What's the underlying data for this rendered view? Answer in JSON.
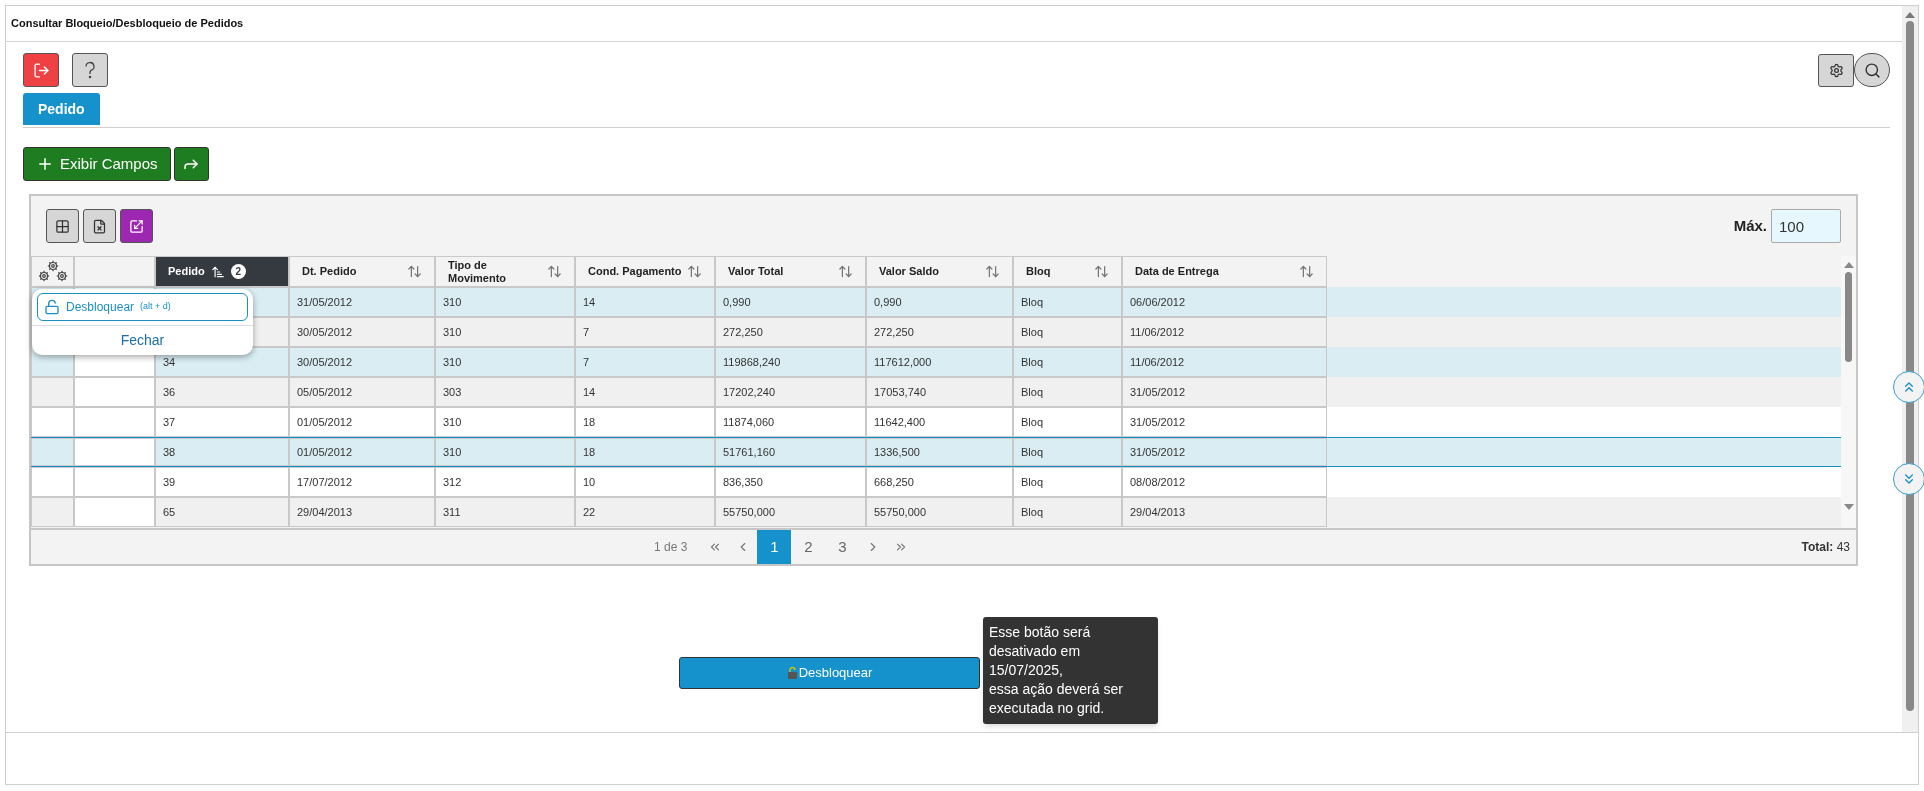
{
  "window": {
    "title": "Consultar Bloqueio/Desbloqueio de Pedidos"
  },
  "tabs": [
    {
      "label": "Pedido",
      "selected": true
    }
  ],
  "actions": {
    "show_fields": "Exibir Campos"
  },
  "grid": {
    "max_label": "Máx.",
    "max_value": "100",
    "columns": [
      {
        "label": "Pedido",
        "sorted": true,
        "sort_badge": "2"
      },
      {
        "label": "Dt. Pedido",
        "sorted": false
      },
      {
        "label": "Tipo de Movimento",
        "sorted": false
      },
      {
        "label": "Cond. Pagamento",
        "sorted": false
      },
      {
        "label": "Valor Total",
        "sorted": false
      },
      {
        "label": "Valor Saldo",
        "sorted": false
      },
      {
        "label": "Bloq",
        "sorted": false
      },
      {
        "label": "Data de Entrega",
        "sorted": false
      }
    ],
    "rows": [
      {
        "values": [
          "31/05/2012",
          "310",
          "14",
          "0,990",
          "0,990",
          "Bloq",
          "06/06/2012"
        ],
        "selected": true,
        "focused": false
      },
      {
        "values": [
          "30/05/2012",
          "310",
          "7",
          "272,250",
          "272,250",
          "Bloq",
          "11/06/2012"
        ],
        "selected": false,
        "focused": false
      },
      {
        "pedido": "34",
        "values": [
          "30/05/2012",
          "310",
          "7",
          "119868,240",
          "117612,000",
          "Bloq",
          "11/06/2012"
        ],
        "selected": true,
        "focused": false
      },
      {
        "pedido": "36",
        "values": [
          "05/05/2012",
          "303",
          "14",
          "17202,240",
          "17053,740",
          "Bloq",
          "31/05/2012"
        ],
        "selected": false,
        "focused": false
      },
      {
        "pedido": "37",
        "values": [
          "01/05/2012",
          "310",
          "18",
          "11874,060",
          "11642,400",
          "Bloq",
          "31/05/2012"
        ],
        "selected": false,
        "focused": false
      },
      {
        "pedido": "38",
        "values": [
          "01/05/2012",
          "310",
          "18",
          "51761,160",
          "1336,500",
          "Bloq",
          "31/05/2012"
        ],
        "selected": true,
        "focused": true
      },
      {
        "pedido": "39",
        "values": [
          "17/07/2012",
          "312",
          "10",
          "836,350",
          "668,250",
          "Bloq",
          "08/08/2012"
        ],
        "selected": false,
        "focused": false
      },
      {
        "pedido": "65",
        "values": [
          "29/04/2013",
          "311",
          "22",
          "55750,000",
          "55750,000",
          "Bloq",
          "29/04/2013"
        ],
        "selected": false,
        "focused": false
      }
    ],
    "row_menu": {
      "unlock": "Desbloquear",
      "shortcut": "(alt + d)",
      "close": "Fechar"
    },
    "pager": {
      "summary": "1 de 3",
      "pages": [
        {
          "label": "1",
          "selected": true
        },
        {
          "label": "2",
          "selected": false
        },
        {
          "label": "3",
          "selected": false
        }
      ],
      "total": "**Total:** 43"
    }
  },
  "unlock_button": "Desbloquear",
  "tooltip": "Esse botão será desativado em 15/07/2025,\nessa ação deverá ser executada no grid."
}
